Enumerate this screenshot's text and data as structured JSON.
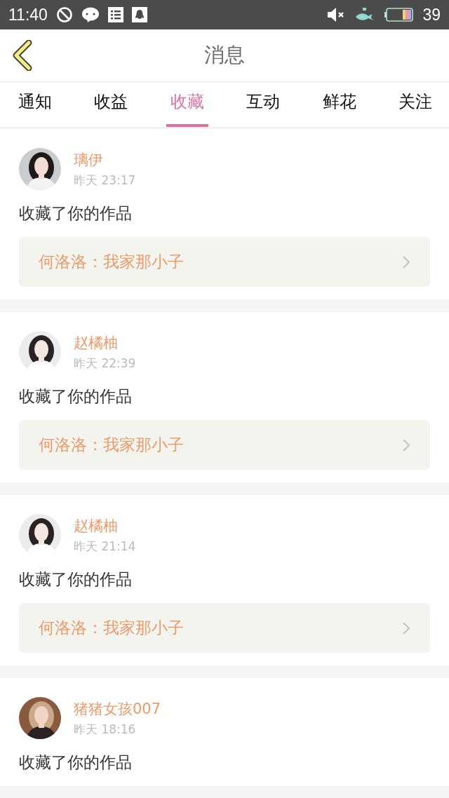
{
  "status_bar": {
    "time": "11:40",
    "battery": "39"
  },
  "header": {
    "title": "消息"
  },
  "tabs": [
    {
      "label": "通知",
      "selected": false
    },
    {
      "label": "收益",
      "selected": false
    },
    {
      "label": "收藏",
      "selected": true
    },
    {
      "label": "互动",
      "selected": false
    },
    {
      "label": "鲜花",
      "selected": false
    },
    {
      "label": "关注",
      "selected": false
    }
  ],
  "messages": [
    {
      "name": "璃伊",
      "time": "昨天 23:17",
      "action": "收藏了你的作品",
      "work": "何洛洛：我家那小子"
    },
    {
      "name": "赵橘柚",
      "time": "昨天 22:39",
      "action": "收藏了你的作品",
      "work": "何洛洛：我家那小子"
    },
    {
      "name": "赵橘柚",
      "time": "昨天 21:14",
      "action": "收藏了你的作品",
      "work": "何洛洛：我家那小子"
    },
    {
      "name": "猪猪女孩007",
      "time": "昨天 18:16",
      "action": "收藏了你的作品"
    }
  ]
}
